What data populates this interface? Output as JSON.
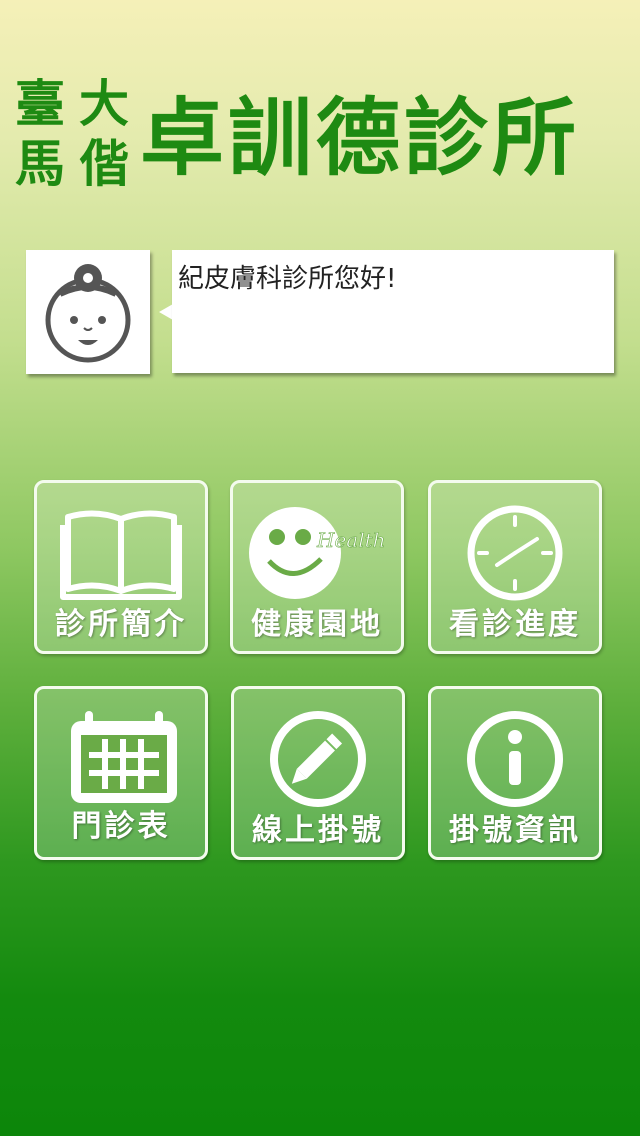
{
  "header": {
    "subtitle_chars": [
      "臺",
      "大",
      "馬",
      "偕"
    ],
    "clinic_name": "卓訓德診所",
    "text_color": "#1e8a12"
  },
  "greeting": {
    "avatar_icon": "doctor-face-icon",
    "message": "紀皮膚科診所您好!"
  },
  "menu": {
    "items": [
      {
        "label": "診所簡介",
        "icon": "book-icon"
      },
      {
        "label": "健康園地",
        "icon": "smiley-health-icon",
        "icon_text": "Health"
      },
      {
        "label": "看診進度",
        "icon": "clock-icon"
      },
      {
        "label": "門診表",
        "icon": "calendar-icon"
      },
      {
        "label": "線上掛號",
        "icon": "pencil-icon"
      },
      {
        "label": "掛號資訊",
        "icon": "info-icon"
      }
    ]
  },
  "colors": {
    "background_top": "#f5f0b8",
    "background_bottom": "#0c860a",
    "tile_border": "#f4fbee"
  }
}
